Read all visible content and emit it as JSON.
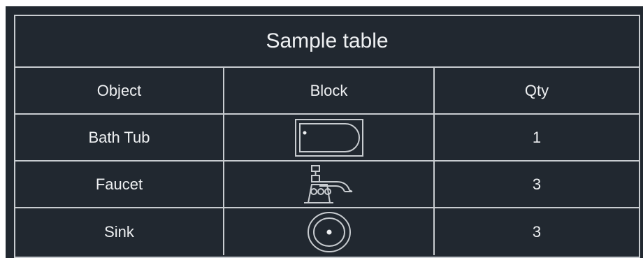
{
  "table": {
    "title": "Sample table",
    "headers": {
      "object": "Object",
      "block": "Block",
      "qty": "Qty"
    },
    "rows": [
      {
        "object": "Bath Tub",
        "block_icon": "bathtub-icon",
        "qty": "1"
      },
      {
        "object": "Faucet",
        "block_icon": "faucet-icon",
        "qty": "3"
      },
      {
        "object": "Sink",
        "block_icon": "sink-icon",
        "qty": "3"
      }
    ]
  },
  "colors": {
    "background": "#212830",
    "grid_lines": "#c8ccd0",
    "text": "#eef0f2"
  }
}
